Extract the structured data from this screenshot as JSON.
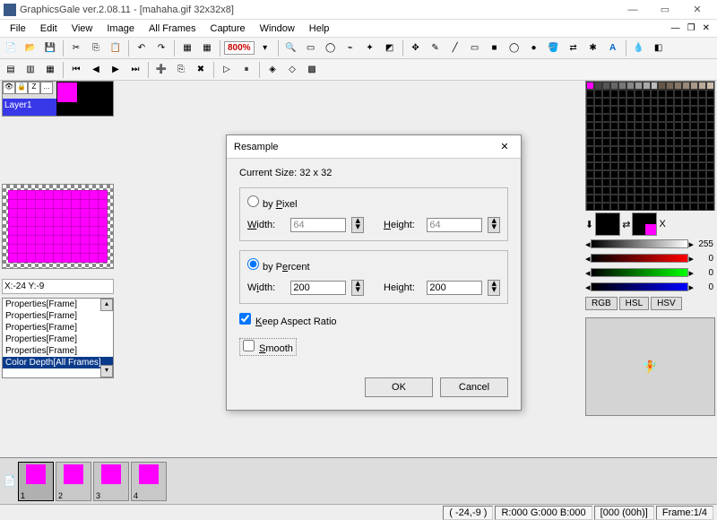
{
  "titlebar": {
    "title": "GraphicsGale ver.2.08.11 - [mahaha.gif 32x32x8]"
  },
  "menu": {
    "file": "File",
    "edit": "Edit",
    "view": "View",
    "image": "Image",
    "allframes": "All Frames",
    "capture": "Capture",
    "window": "Window",
    "help": "Help"
  },
  "toolbar": {
    "zoom": "800%"
  },
  "layers": {
    "label": "Layer1"
  },
  "coord": "X:-24 Y:-9",
  "history": {
    "items": [
      "Properties[Frame]",
      "Properties[Frame]",
      "Properties[Frame]",
      "Properties[Frame]",
      "Properties[Frame]",
      "Color Depth[All Frames]"
    ]
  },
  "color": {
    "value": "255",
    "r": "0",
    "g": "0",
    "b": "0",
    "tab_rgb": "RGB",
    "tab_hsl": "HSL",
    "tab_hsv": "HSV"
  },
  "frames": [
    "1",
    "2",
    "3",
    "4"
  ],
  "status": {
    "pos": "( -24,-9 )",
    "rgb": "R:000 G:000 B:000",
    "idx": "[000 (00h)]",
    "frame": "Frame:1/4"
  },
  "dialog": {
    "title": "Resample",
    "cursize": "Current Size: 32 x 32",
    "by_pixel": "by Pixel",
    "by_percent": "by Percent",
    "width_lbl": "Width:",
    "height_lbl": "Height:",
    "px_w": "64",
    "px_h": "64",
    "pc_w": "200",
    "pc_h": "200",
    "keep_aspect": "Keep Aspect Ratio",
    "smooth": "Smooth",
    "ok": "OK",
    "cancel": "Cancel"
  }
}
